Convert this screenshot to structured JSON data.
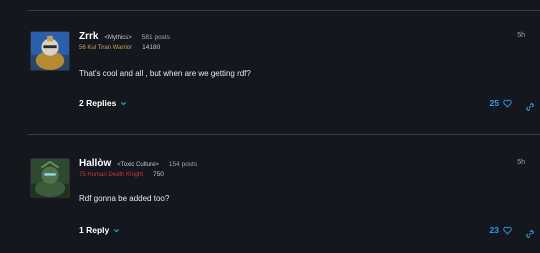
{
  "comments": [
    {
      "author": "Zrrk",
      "guild": "<Mythics>",
      "post_count": "581 posts",
      "character": "56 Kul Tiran Warrior",
      "achievements": "14180",
      "time": "5h",
      "body": "That's cool and all , but when are we getting rdf?",
      "replies_label": "2 Replies",
      "likes": "25",
      "character_color": "#d49d5b"
    },
    {
      "author": "Hallòw",
      "guild": "<Toxic Culture>",
      "post_count": "154 posts",
      "character": "75 Human Death Knight",
      "achievements": "750",
      "time": "5h",
      "body": "Rdf gonna be added too?",
      "replies_label": "1 Reply",
      "likes": "23",
      "character_color": "#c8353c"
    }
  ],
  "colors": {
    "background": "#15171e",
    "accent": "#2c9ee8",
    "divider": "#3a3d46"
  },
  "icons": [
    "chevron-down-icon",
    "heart-icon",
    "link-icon"
  ]
}
